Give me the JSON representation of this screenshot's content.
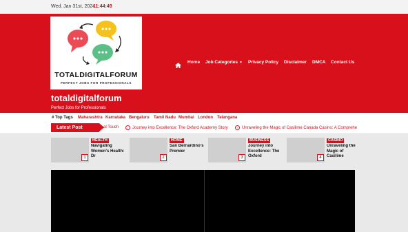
{
  "topbar": {
    "date": "Wed. Jan 31st, 2024",
    "time": "11:44:49"
  },
  "logo": {
    "title": "TOTALDIGITALFORUM",
    "subtitle": "PERFECT JOBS FOR PROFESSIONALS"
  },
  "nav": {
    "home_icon": "home-icon",
    "items": [
      "Home",
      "Job Categories",
      "Privacy Policy",
      "Disclaimer",
      "DMCA",
      "Contact Us"
    ]
  },
  "site": {
    "title": "totaldigitalforum",
    "tagline": "Perfect Jobs for Professionals"
  },
  "tags": {
    "label": "Top Tags",
    "items": [
      "Maharashtra",
      "Karnataka",
      "Bengaluru",
      "Tamil Nadu",
      "Mumbai",
      "London",
      "Telangana"
    ]
  },
  "latest": {
    "label": "Latest Post",
    "items": [
      "al Touch",
      "Journey into Excellence: The Oxford Academy Story",
      "Unraveling the Magic of Casilime Canada Casino: A Comprehe"
    ]
  },
  "cards": [
    {
      "num": "1",
      "category": "HEALTH",
      "title": "Navigating Women's Health: Dr"
    },
    {
      "num": "2",
      "category": "HOME",
      "title": "San Bernardino's Premier"
    },
    {
      "num": "3",
      "category": "BUSINESS",
      "title": "Journey into Excellence: The Oxford"
    },
    {
      "num": "4",
      "category": "CASINO",
      "title": "Unraveling the Magic of Casilime"
    }
  ],
  "colors": {
    "brand_red": "#d8101c",
    "accent_red": "#d0101d"
  }
}
